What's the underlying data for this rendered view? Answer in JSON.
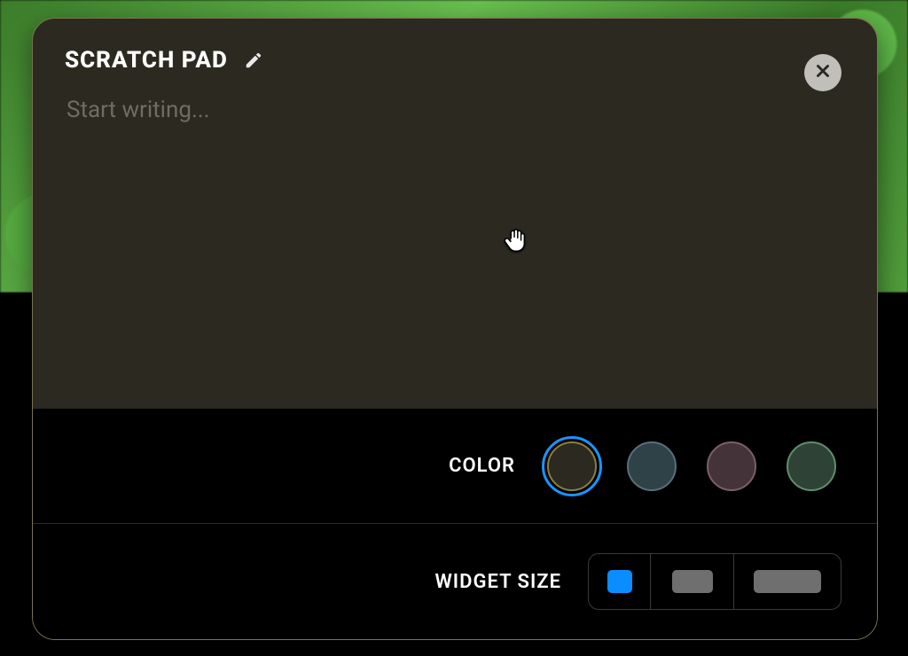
{
  "widget": {
    "title": "SCRATCH PAD",
    "placeholder": "Start writing...",
    "value": ""
  },
  "settings": {
    "color": {
      "label": "COLOR",
      "selected_index": 0,
      "options": [
        {
          "name": "olive",
          "fill": "#2b2920",
          "ring": "#8a7f3f"
        },
        {
          "name": "slate",
          "fill": "#2f4248",
          "ring": "#57707a"
        },
        {
          "name": "mauve",
          "fill": "#45333a",
          "ring": "#7b5f68"
        },
        {
          "name": "forest",
          "fill": "#2f4236",
          "ring": "#5f8f6d"
        }
      ]
    },
    "size": {
      "label": "WIDGET SIZE",
      "selected_index": 0,
      "options": [
        "small",
        "medium",
        "large"
      ]
    }
  },
  "accent_color": "#0a8dff"
}
